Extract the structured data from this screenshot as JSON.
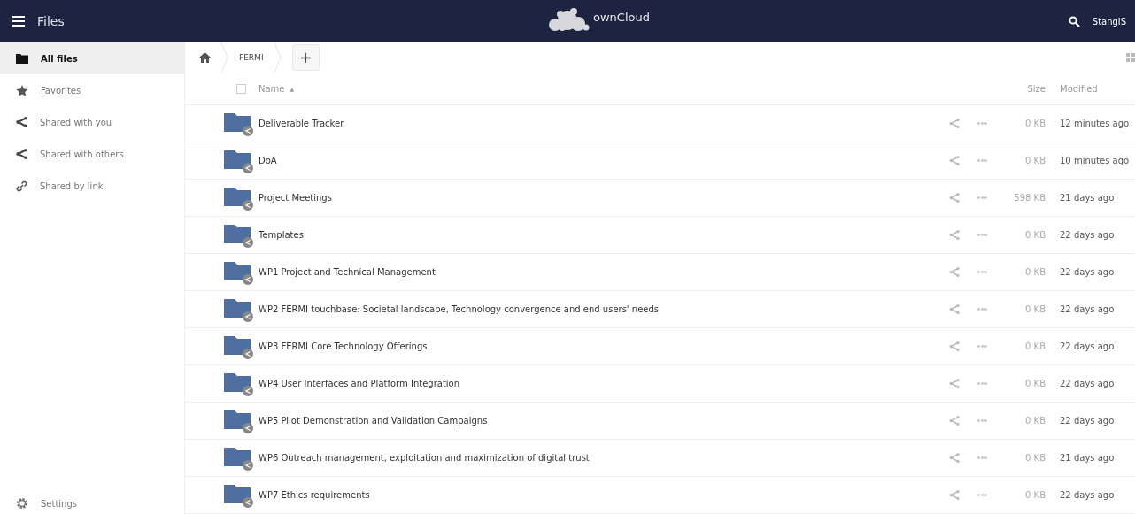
{
  "header": {
    "app_title": "Files",
    "brand": "ownCloud",
    "user": "StanglS"
  },
  "sidebar": {
    "items": [
      {
        "label": "All files",
        "kind": "folder",
        "selected": true
      },
      {
        "label": "Favorites",
        "kind": "favorites",
        "selected": false
      },
      {
        "label": "Shared with you",
        "kind": "shared",
        "selected": false
      },
      {
        "label": "Shared with others",
        "kind": "shared",
        "selected": false
      },
      {
        "label": "Shared by link",
        "kind": "link",
        "selected": false
      }
    ],
    "settings": "Settings"
  },
  "breadcrumb": [
    "FERMI"
  ],
  "new_button": "+",
  "table": {
    "select_all_checked": false,
    "columns": {
      "name": "Name",
      "sort_arrow": "▲",
      "size": "Size",
      "modified": "Modified"
    },
    "rows": [
      {
        "name": "Deliverable Tracker",
        "size": "0 KB",
        "modified": "12 minutes ago"
      },
      {
        "name": "DoA",
        "size": "0 KB",
        "modified": "10 minutes ago"
      },
      {
        "name": "Project Meetings",
        "size": "598 KB",
        "modified": "21 days ago"
      },
      {
        "name": "Templates",
        "size": "0 KB",
        "modified": "22 days ago"
      },
      {
        "name": "WP1 Project and Technical Management",
        "size": "0 KB",
        "modified": "22 days ago"
      },
      {
        "name": "WP2 FERMI touchbase: Societal landscape, Technology convergence and end users' needs",
        "size": "0 KB",
        "modified": "22 days ago"
      },
      {
        "name": "WP3 FERMI Core Technology Offerings",
        "size": "0 KB",
        "modified": "22 days ago"
      },
      {
        "name": "WP4 User Interfaces and Platform Integration",
        "size": "0 KB",
        "modified": "22 days ago"
      },
      {
        "name": "WP5 Pilot Demonstration and Validation Campaigns",
        "size": "0 KB",
        "modified": "22 days ago"
      },
      {
        "name": "WP6 Outreach management, exploitation and maximization of digital trust",
        "size": "0 KB",
        "modified": "21 days ago"
      },
      {
        "name": "WP7 Ethics requirements",
        "size": "0 KB",
        "modified": "22 days ago"
      }
    ]
  }
}
